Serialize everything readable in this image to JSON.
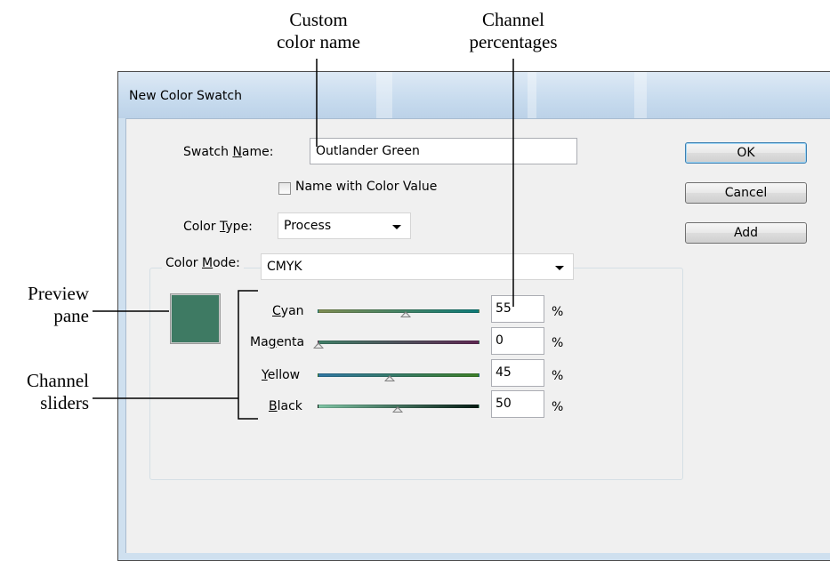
{
  "annotations": {
    "custom_color_name": "Custom\ncolor name",
    "channel_percentages": "Channel\npercentages",
    "preview_pane": "Preview\npane",
    "channel_sliders": "Channel\nsliders"
  },
  "dialog": {
    "title": "New Color Swatch",
    "swatch_name_label": "Swatch Name:",
    "swatch_name_value": "Outlander Green",
    "name_with_color_value_label": "Name with Color Value",
    "name_with_color_value_checked": false,
    "color_type_label": "Color Type:",
    "color_type_value": "Process",
    "color_mode_label": "Color Mode:",
    "color_mode_value": "CMYK",
    "buttons": {
      "ok": "OK",
      "cancel": "Cancel",
      "add": "Add"
    },
    "preview_color": "#3e7a63",
    "channels": [
      {
        "name": "Cyan",
        "value": "55",
        "unit": "%",
        "fraction": 0.55,
        "track_start": "#7e8c52",
        "track_end": "#0e7a77"
      },
      {
        "name": "Magenta",
        "value": "0",
        "unit": "%",
        "fraction": 0.0,
        "track_start": "#3f7e66",
        "track_end": "#5e2752"
      },
      {
        "name": "Yellow",
        "value": "45",
        "unit": "%",
        "fraction": 0.45,
        "track_start": "#2f76a2",
        "track_end": "#3c7e28"
      },
      {
        "name": "Black",
        "value": "50",
        "unit": "%",
        "fraction": 0.5,
        "track_start": "#7fc5a5",
        "track_end": "#051c14"
      }
    ]
  }
}
